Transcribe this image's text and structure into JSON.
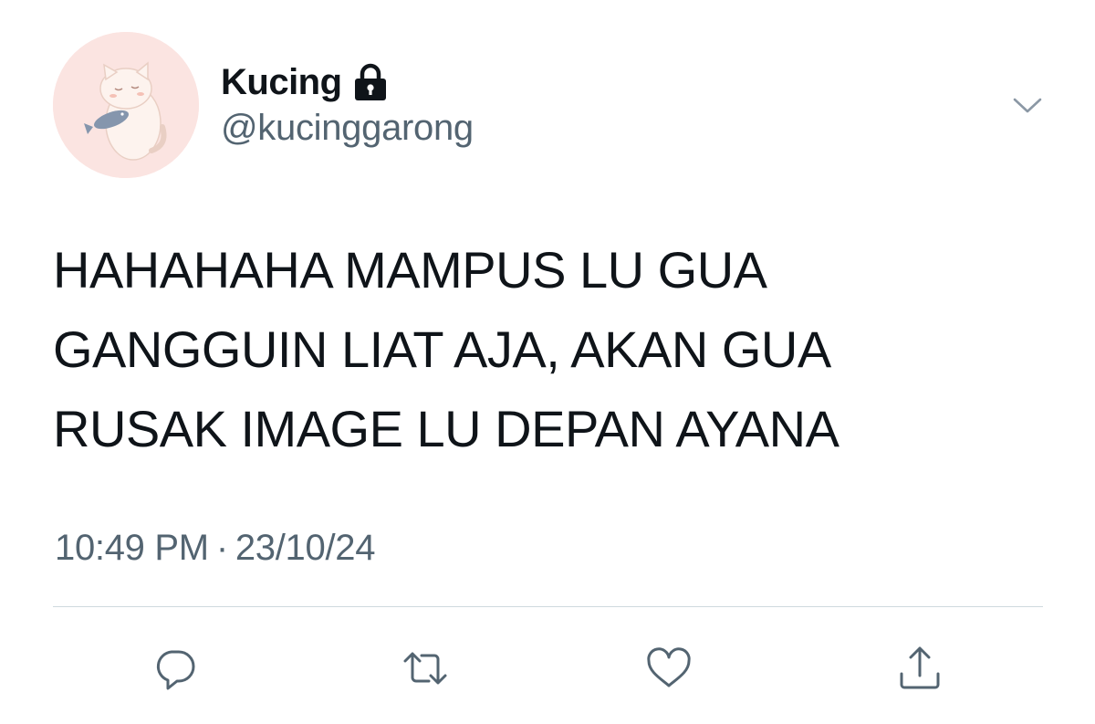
{
  "user": {
    "display_name": "Kucing",
    "handle": "@kucinggarong",
    "protected_icon": "lock-icon",
    "avatar_icon": "cat-holding-fish-avatar"
  },
  "tweet": {
    "text": "HAHAHAHA MAMPUS LU GUA\nGANGGUIN LIAT AJA, AKAN GUA\nRUSAK IMAGE LU DEPAN AYANA",
    "time": "10:49 PM",
    "separator": "·",
    "date": "23/10/24"
  },
  "actions": [
    "reply-icon",
    "retweet-icon",
    "like-icon",
    "share-icon"
  ],
  "menu_icon": "chevron-down-icon",
  "colors": {
    "text": "#0f1419",
    "secondary": "#536471",
    "avatar_bg": "#fbe4e1",
    "divider": "#cfd9de"
  }
}
